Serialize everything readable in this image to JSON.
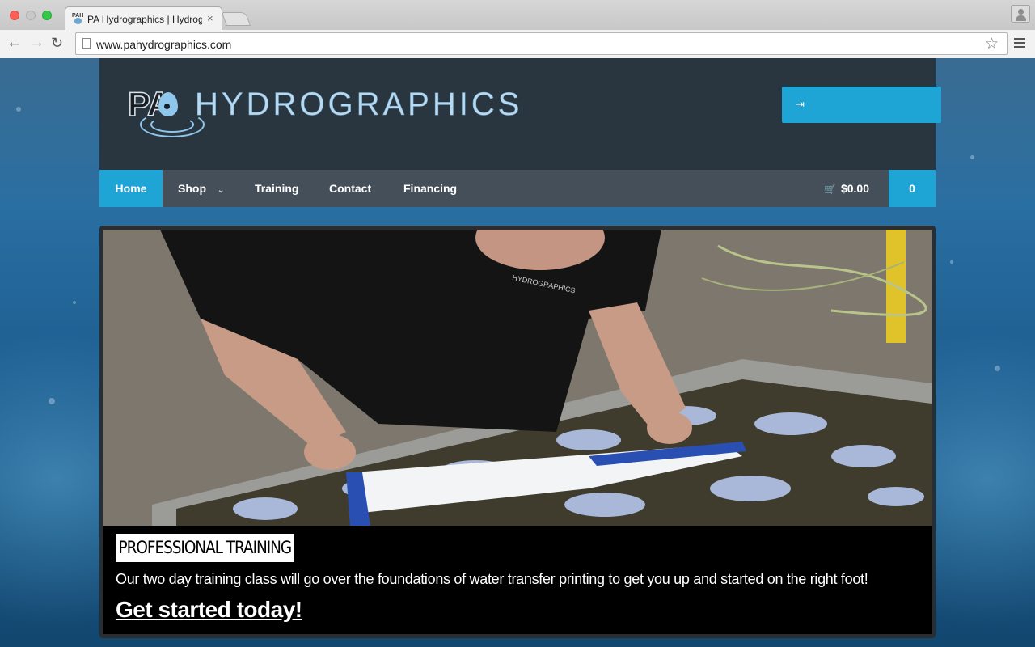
{
  "browser": {
    "tab_title": "PA Hydrographics | Hydrographics",
    "tab_favicon_text": "PAH",
    "tab_close": "×",
    "url": "www.pahydrographics.com",
    "back_glyph": "←",
    "forward_glyph": "→",
    "reload_glyph": "↻",
    "star_glyph": "☆"
  },
  "header": {
    "logo_mark": "PA",
    "logo_name": "HYDROGRAPHICS",
    "login_icon": "⇥"
  },
  "nav": {
    "items": [
      {
        "label": "Home",
        "active": true
      },
      {
        "label": "Shop",
        "has_dropdown": true
      },
      {
        "label": "Training"
      },
      {
        "label": "Contact"
      },
      {
        "label": "Financing"
      }
    ],
    "dropdown_glyph": "⌄",
    "cart_icon": "🛒",
    "cart_total": "$0.00",
    "cart_count": "0"
  },
  "slide": {
    "photo_shirt_text": "HYDROGRAPHICS",
    "caption_title": "PROFESSIONAL TRAINING",
    "caption_text": "Our two day training class will go over the foundations of water transfer printing to get you up and started on the right foot!",
    "cta": "Get started today!"
  },
  "colors": {
    "accent": "#1fa4d6",
    "header_bg": "#29353f",
    "nav_bg": "#444f59"
  }
}
